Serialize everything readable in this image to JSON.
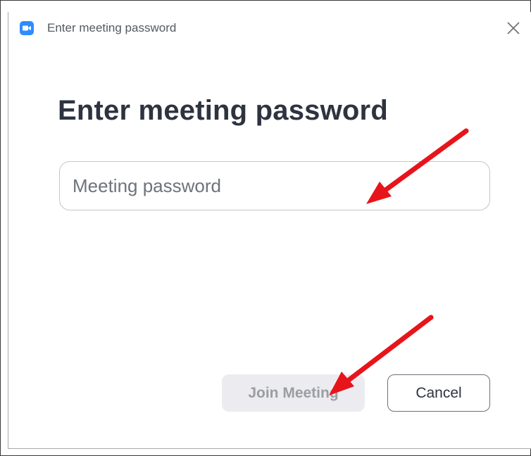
{
  "window": {
    "title": "Enter meeting password"
  },
  "dialog": {
    "heading": "Enter meeting password",
    "password_input": {
      "value": "",
      "placeholder": "Meeting password"
    },
    "join_label": "Join Meeting",
    "cancel_label": "Cancel",
    "join_enabled": false
  },
  "icons": {
    "app": "zoom-camera-icon",
    "close": "close-icon",
    "annotation": "red-arrow-icon"
  },
  "colors": {
    "accent": "#2d8cff",
    "annotation": "#e8141b",
    "heading": "#2e3340",
    "disabled_button_bg": "#ececf0",
    "disabled_button_text": "#9a9da4"
  }
}
